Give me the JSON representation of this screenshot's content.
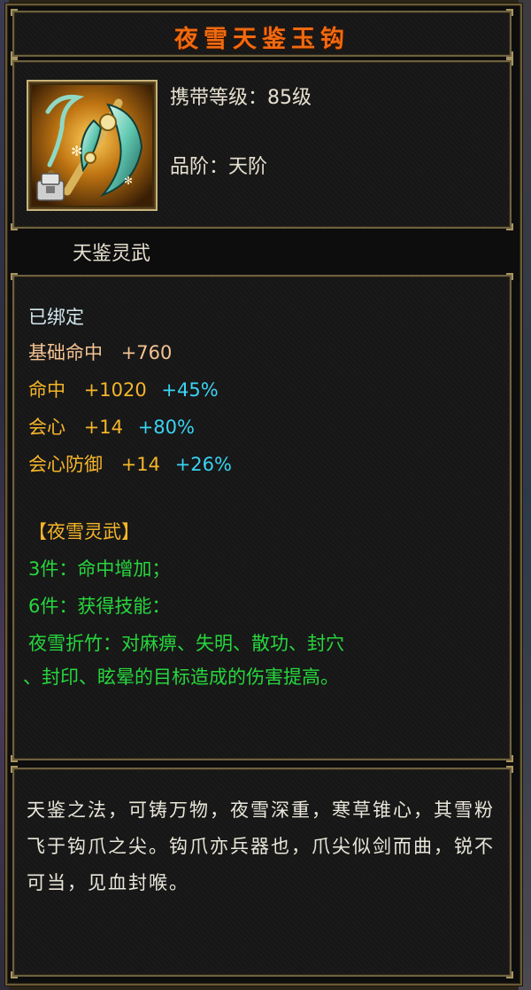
{
  "item": {
    "name": "夜雪天鉴玉钩",
    "level_label": "携带等级：85级",
    "grade_label": "品阶：天阶",
    "category": "天鉴灵武"
  },
  "stats": {
    "bound": "已绑定",
    "rows": [
      {
        "label": "基础命中",
        "value": "+760",
        "bonus": ""
      },
      {
        "label": "命中",
        "value": "+1020",
        "bonus": "+45%"
      },
      {
        "label": "会心",
        "value": "+14",
        "bonus": "+80%"
      },
      {
        "label": "会心防御",
        "value": "+14",
        "bonus": "+26%"
      }
    ]
  },
  "set": {
    "name": "【夜雪灵武】",
    "bonus3": "3件：命中增加；",
    "bonus6": "6件：获得技能：",
    "skill_line1": "夜雪折竹：对麻痹、失明、散功、封穴",
    "skill_line2": "、封印、眩晕的目标造成的伤害提高。"
  },
  "description": "天鉴之法，可铸万物，夜雪深重，寒草锥心，其雪粉飞于钩爪之尖。钩爪亦兵器也，爪尖似剑而曲，锐不可当，见血封喉。",
  "icons": {
    "item_icon": "jade-hook-weapon-icon",
    "bound_badge": "lock-badge-icon"
  },
  "colors": {
    "title": "#f06a10",
    "base_stat": "#f4c392",
    "stat": "#f5b52a",
    "bonus": "#3ad3f3",
    "set_text": "#27d63d"
  }
}
